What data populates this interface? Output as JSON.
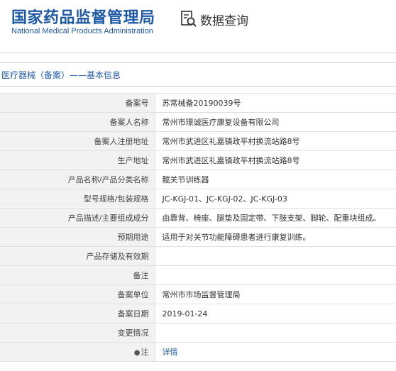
{
  "header": {
    "logo_cn": "国家药品监督管理局",
    "logo_en": "National Medical Products Administration",
    "query_label": "数据查询",
    "query_icon": "document-search-icon"
  },
  "breadcrumb": {
    "text": "医疗器械（备案）——基本信息"
  },
  "rows": [
    {
      "label": "备案号",
      "value": "苏常械备20190039号"
    },
    {
      "label": "备案人名称",
      "value": "常州市璟诚医疗康复设备有限公司"
    },
    {
      "label": "备案人注册地址",
      "value": "常州市武进区礼嘉镇政平村换流站路8号"
    },
    {
      "label": "生产地址",
      "value": "常州市武进区礼嘉镇政平村换流站路8号"
    },
    {
      "label": "产品名称/产品分类名称",
      "value": "髋关节训练器"
    },
    {
      "label": "型号规格/包装规格",
      "value": "JC-KGJ-01、JC-KGJ-02、JC-KGJ-03"
    },
    {
      "label": "产品描述/主要组成成分",
      "value": "由靠背、椅座、腿垫及固定带、下肢支架、脚轮、配重块组成。"
    },
    {
      "label": "预期用途",
      "value": "适用于对关节功能障碍患者进行康复训练。"
    },
    {
      "label": "产品存储及有效期",
      "value": ""
    },
    {
      "label": "备注",
      "value": ""
    },
    {
      "label": "备案单位",
      "value": "常州市市场监督管理局"
    },
    {
      "label": "备案日期",
      "value": "2019-01-24"
    },
    {
      "label": "变更情况",
      "value": ""
    },
    {
      "label": "注",
      "value": "详情",
      "icon": "pin-icon"
    }
  ],
  "colors": {
    "brand_blue": "#1f5aa6",
    "label_bg": "#f2f2f2",
    "border": "#e0e0e0"
  }
}
